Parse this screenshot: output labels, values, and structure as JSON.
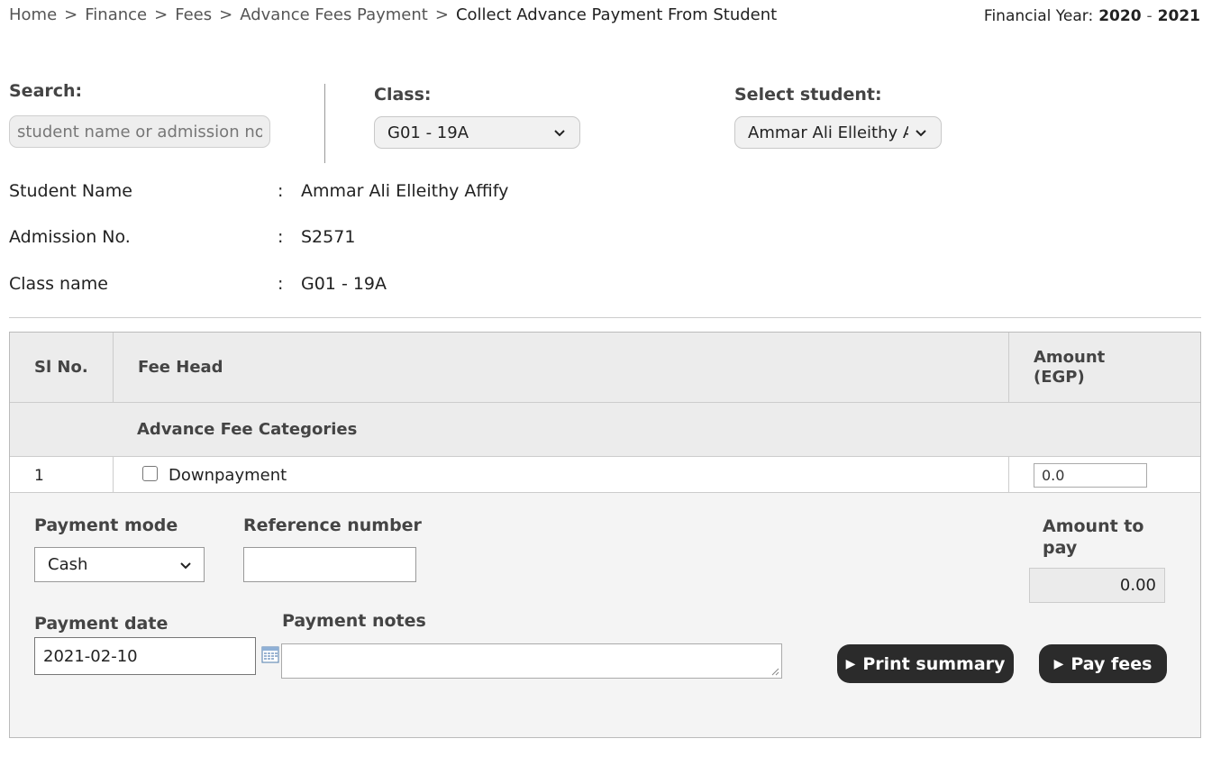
{
  "breadcrumb": {
    "items": [
      "Home",
      "Finance",
      "Fees",
      "Advance Fees Payment"
    ],
    "separator": ">",
    "current": "Collect Advance Payment From Student"
  },
  "financial_year": {
    "label": "Financial Year:",
    "start": "2020",
    "end": "2021"
  },
  "filters": {
    "search": {
      "label": "Search:",
      "placeholder": "student name or admission no",
      "value": ""
    },
    "class": {
      "label": "Class:",
      "selected": "G01 - 19A"
    },
    "student": {
      "label": "Select student:",
      "selected": "Ammar Ali Elleithy Affify"
    }
  },
  "student_info": {
    "name": {
      "label": "Student Name",
      "value": "Ammar Ali Elleithy Affify"
    },
    "admission": {
      "label": "Admission No.",
      "value": "S2571"
    },
    "class": {
      "label": "Class name",
      "value": "G01 - 19A"
    },
    "colon": ":"
  },
  "table": {
    "headers": {
      "sl": "Sl No.",
      "fee_head": "Fee Head",
      "amount_line1": "Amount",
      "amount_line2": "(EGP)"
    },
    "category": "Advance Fee Categories",
    "rows": [
      {
        "sl": "1",
        "fee_head": "Downpayment",
        "checked": false,
        "amount": "0.0"
      }
    ]
  },
  "payment": {
    "mode": {
      "label": "Payment mode",
      "selected": "Cash"
    },
    "reference": {
      "label": "Reference number",
      "value": ""
    },
    "amount_to_pay": {
      "label_line1": "Amount to",
      "label_line2": "pay",
      "value": "0.00"
    },
    "date": {
      "label": "Payment date",
      "value": "2021-02-10"
    },
    "notes": {
      "label": "Payment notes",
      "value": ""
    },
    "print_button": "Print summary",
    "pay_button": "Pay fees"
  },
  "icons": {
    "chevron": "chevron-down-icon",
    "calendar": "calendar-icon",
    "play": "play-triangle-icon"
  }
}
